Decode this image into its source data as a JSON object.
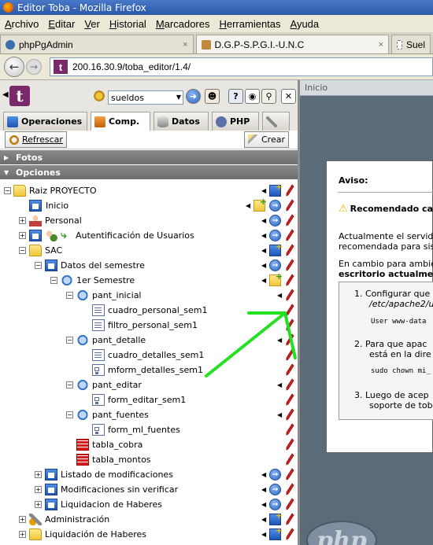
{
  "window": {
    "title": "Editor Toba - Mozilla Firefox"
  },
  "menubar": {
    "items": [
      "Archivo",
      "Editar",
      "Ver",
      "Historial",
      "Marcadores",
      "Herramientas",
      "Ayuda"
    ]
  },
  "browser_tabs": [
    {
      "label": "phpPgAdmin",
      "close": "×"
    },
    {
      "label": "D.G.P-S.P.G.I.-U.N.C",
      "close": "×"
    },
    {
      "label": "Suel"
    }
  ],
  "navbar": {
    "url": "200.16.30.9/toba_editor/1.4/"
  },
  "toolbar": {
    "project_select": "sueldos"
  },
  "main_tabs": [
    "Operaciones",
    "Comp.",
    "Datos",
    "PHP"
  ],
  "actions": {
    "refresh": "Refrescar",
    "create": "Crear"
  },
  "sections": {
    "fotos": "Fotos",
    "opciones": "Opciones"
  },
  "tree": [
    {
      "label": "Raiz PROYECTO"
    },
    {
      "label": "Inicio"
    },
    {
      "label": "Personal"
    },
    {
      "label": "Autentificación de Usuarios"
    },
    {
      "label": "SAC"
    },
    {
      "label": "Datos del semestre"
    },
    {
      "label": "1er Semestre"
    },
    {
      "label": "pant_inicial"
    },
    {
      "label": "cuadro_personal_sem1"
    },
    {
      "label": "filtro_personal_sem1"
    },
    {
      "label": "pant_detalle"
    },
    {
      "label": "cuadro_detalles_sem1"
    },
    {
      "label": "mform_detalles_sem1"
    },
    {
      "label": "pant_editar"
    },
    {
      "label": "form_editar_sem1"
    },
    {
      "label": "pant_fuentes"
    },
    {
      "label": "form_ml_fuentes"
    },
    {
      "label": "tabla_cobra"
    },
    {
      "label": "tabla_montos"
    },
    {
      "label": "Listado de modificaciones"
    },
    {
      "label": "Modificaciones sin verificar"
    },
    {
      "label": "Liquidacion de Haberes"
    },
    {
      "label": "Administración"
    },
    {
      "label": "Liquidación de Haberes"
    }
  ],
  "right_panel": {
    "header": "Inicio",
    "dialog": {
      "title": "Aviso:",
      "warning": "Recomendado car",
      "p1_line1": "Actualmente el servid",
      "p1_line2": "recomendada para sis",
      "p2_line1": "En cambio para ambie",
      "p2_line2": "escritorio actualment",
      "step1_line1": "1. Configurar que",
      "step1_line2": "/etc/apache2/u",
      "step1_code": "User www-data",
      "step2_line1": "2. Para que apac",
      "step2_line2": "está en la dire",
      "step2_code": "sudo chown mi_",
      "step3_line1": "3. Luego de acep",
      "step3_line2": "soporte de tob"
    },
    "logo_text": "php"
  },
  "colors": {
    "annotation_arrow": "#22e022",
    "toba_brand": "#7a2a6a",
    "section_bar": "#7a7a7a",
    "right_bg": "#5c6b78"
  }
}
